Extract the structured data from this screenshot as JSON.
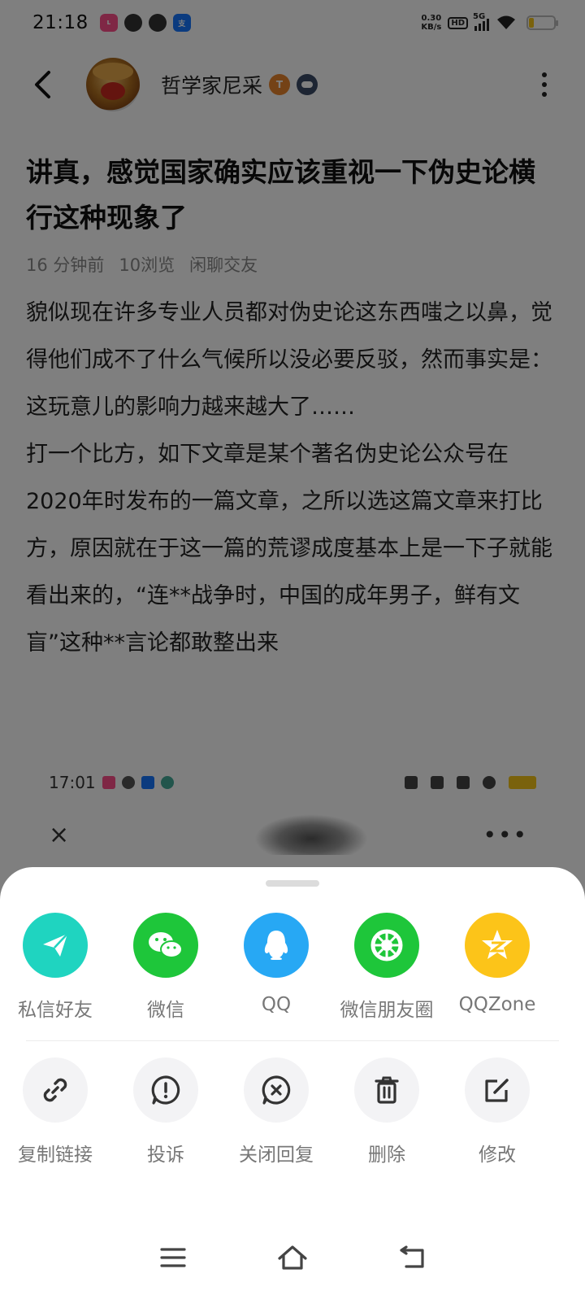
{
  "status_bar": {
    "time": "21:18",
    "net_speed": "0.30",
    "net_unit": "KB/s",
    "hd": "HD",
    "network": "5G"
  },
  "header": {
    "username": "哲学家尼采",
    "badge_t": "T"
  },
  "post": {
    "title": "讲真，感觉国家确实应该重视一下伪史论横行这种现象了",
    "time_ago": "16 分钟前",
    "views": "10浏览",
    "category": "闲聊交友",
    "paragraphs": [
      "貌似现在许多专业人员都对伪史论这东西嗤之以鼻，觉得他们成不了什么气候所以没必要反驳，然而事实是：这玩意儿的影响力越来越大了……",
      "打一个比方，如下文章是某个著名伪史论公众号在2020年时发布的一篇文章，之所以选这篇文章来打比方，原因就在于这一篇的荒谬成度基本上是一下子就能看出来的，“连**战争时，中国的成年男子，鲜有文盲”这种**言论都敢整出来"
    ],
    "embedded_screenshot": {
      "time": "17:01",
      "close": "×",
      "more": "•••"
    }
  },
  "share_sheet": {
    "share_targets": [
      {
        "label": "私信好友",
        "icon": "paper-plane-icon",
        "color": "#1fd4c0"
      },
      {
        "label": "微信",
        "icon": "wechat-icon",
        "color": "#1ec63a"
      },
      {
        "label": "QQ",
        "icon": "qq-penguin-icon",
        "color": "#27a8f4"
      },
      {
        "label": "微信朋友圈",
        "icon": "wechat-moments-icon",
        "color": "#1ec63a"
      },
      {
        "label": "QQZone",
        "icon": "qzone-star-icon",
        "color": "#fcc419"
      }
    ],
    "actions": [
      {
        "label": "复制链接",
        "icon": "link-icon"
      },
      {
        "label": "投诉",
        "icon": "report-icon"
      },
      {
        "label": "关闭回复",
        "icon": "close-reply-icon"
      },
      {
        "label": "删除",
        "icon": "trash-icon"
      },
      {
        "label": "修改",
        "icon": "edit-icon"
      }
    ]
  },
  "nav": {
    "icons": [
      "menu-icon",
      "home-icon",
      "back-icon"
    ]
  }
}
